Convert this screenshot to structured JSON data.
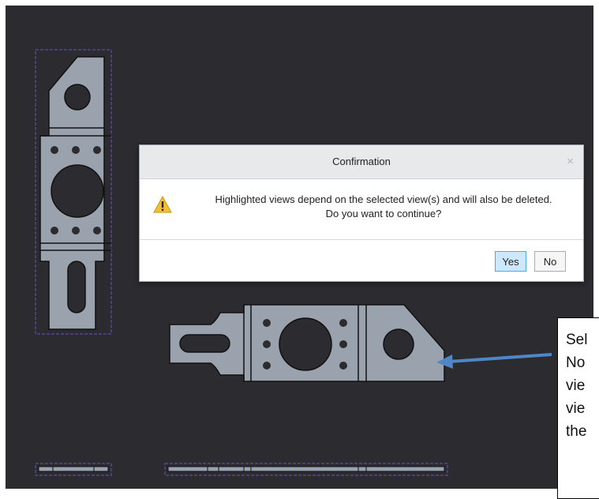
{
  "dialog": {
    "title": "Confirmation",
    "close_glyph": "×",
    "message_line1": "Highlighted views depend on the selected view(s) and will also be deleted.",
    "message_line2": "Do you want to continue?",
    "icon": "warning-icon",
    "yes_label": "Yes",
    "no_label": "No"
  },
  "callout": {
    "text": "Sel\nNo\nvie\nvie\nthe"
  },
  "colors": {
    "canvas_background": "#2c2c30",
    "part_fill": "#9aa2ad",
    "view_boundary": "#6a4fc2",
    "callout_arrow": "#4f86c6",
    "warning_yellow": "#f3c030"
  }
}
